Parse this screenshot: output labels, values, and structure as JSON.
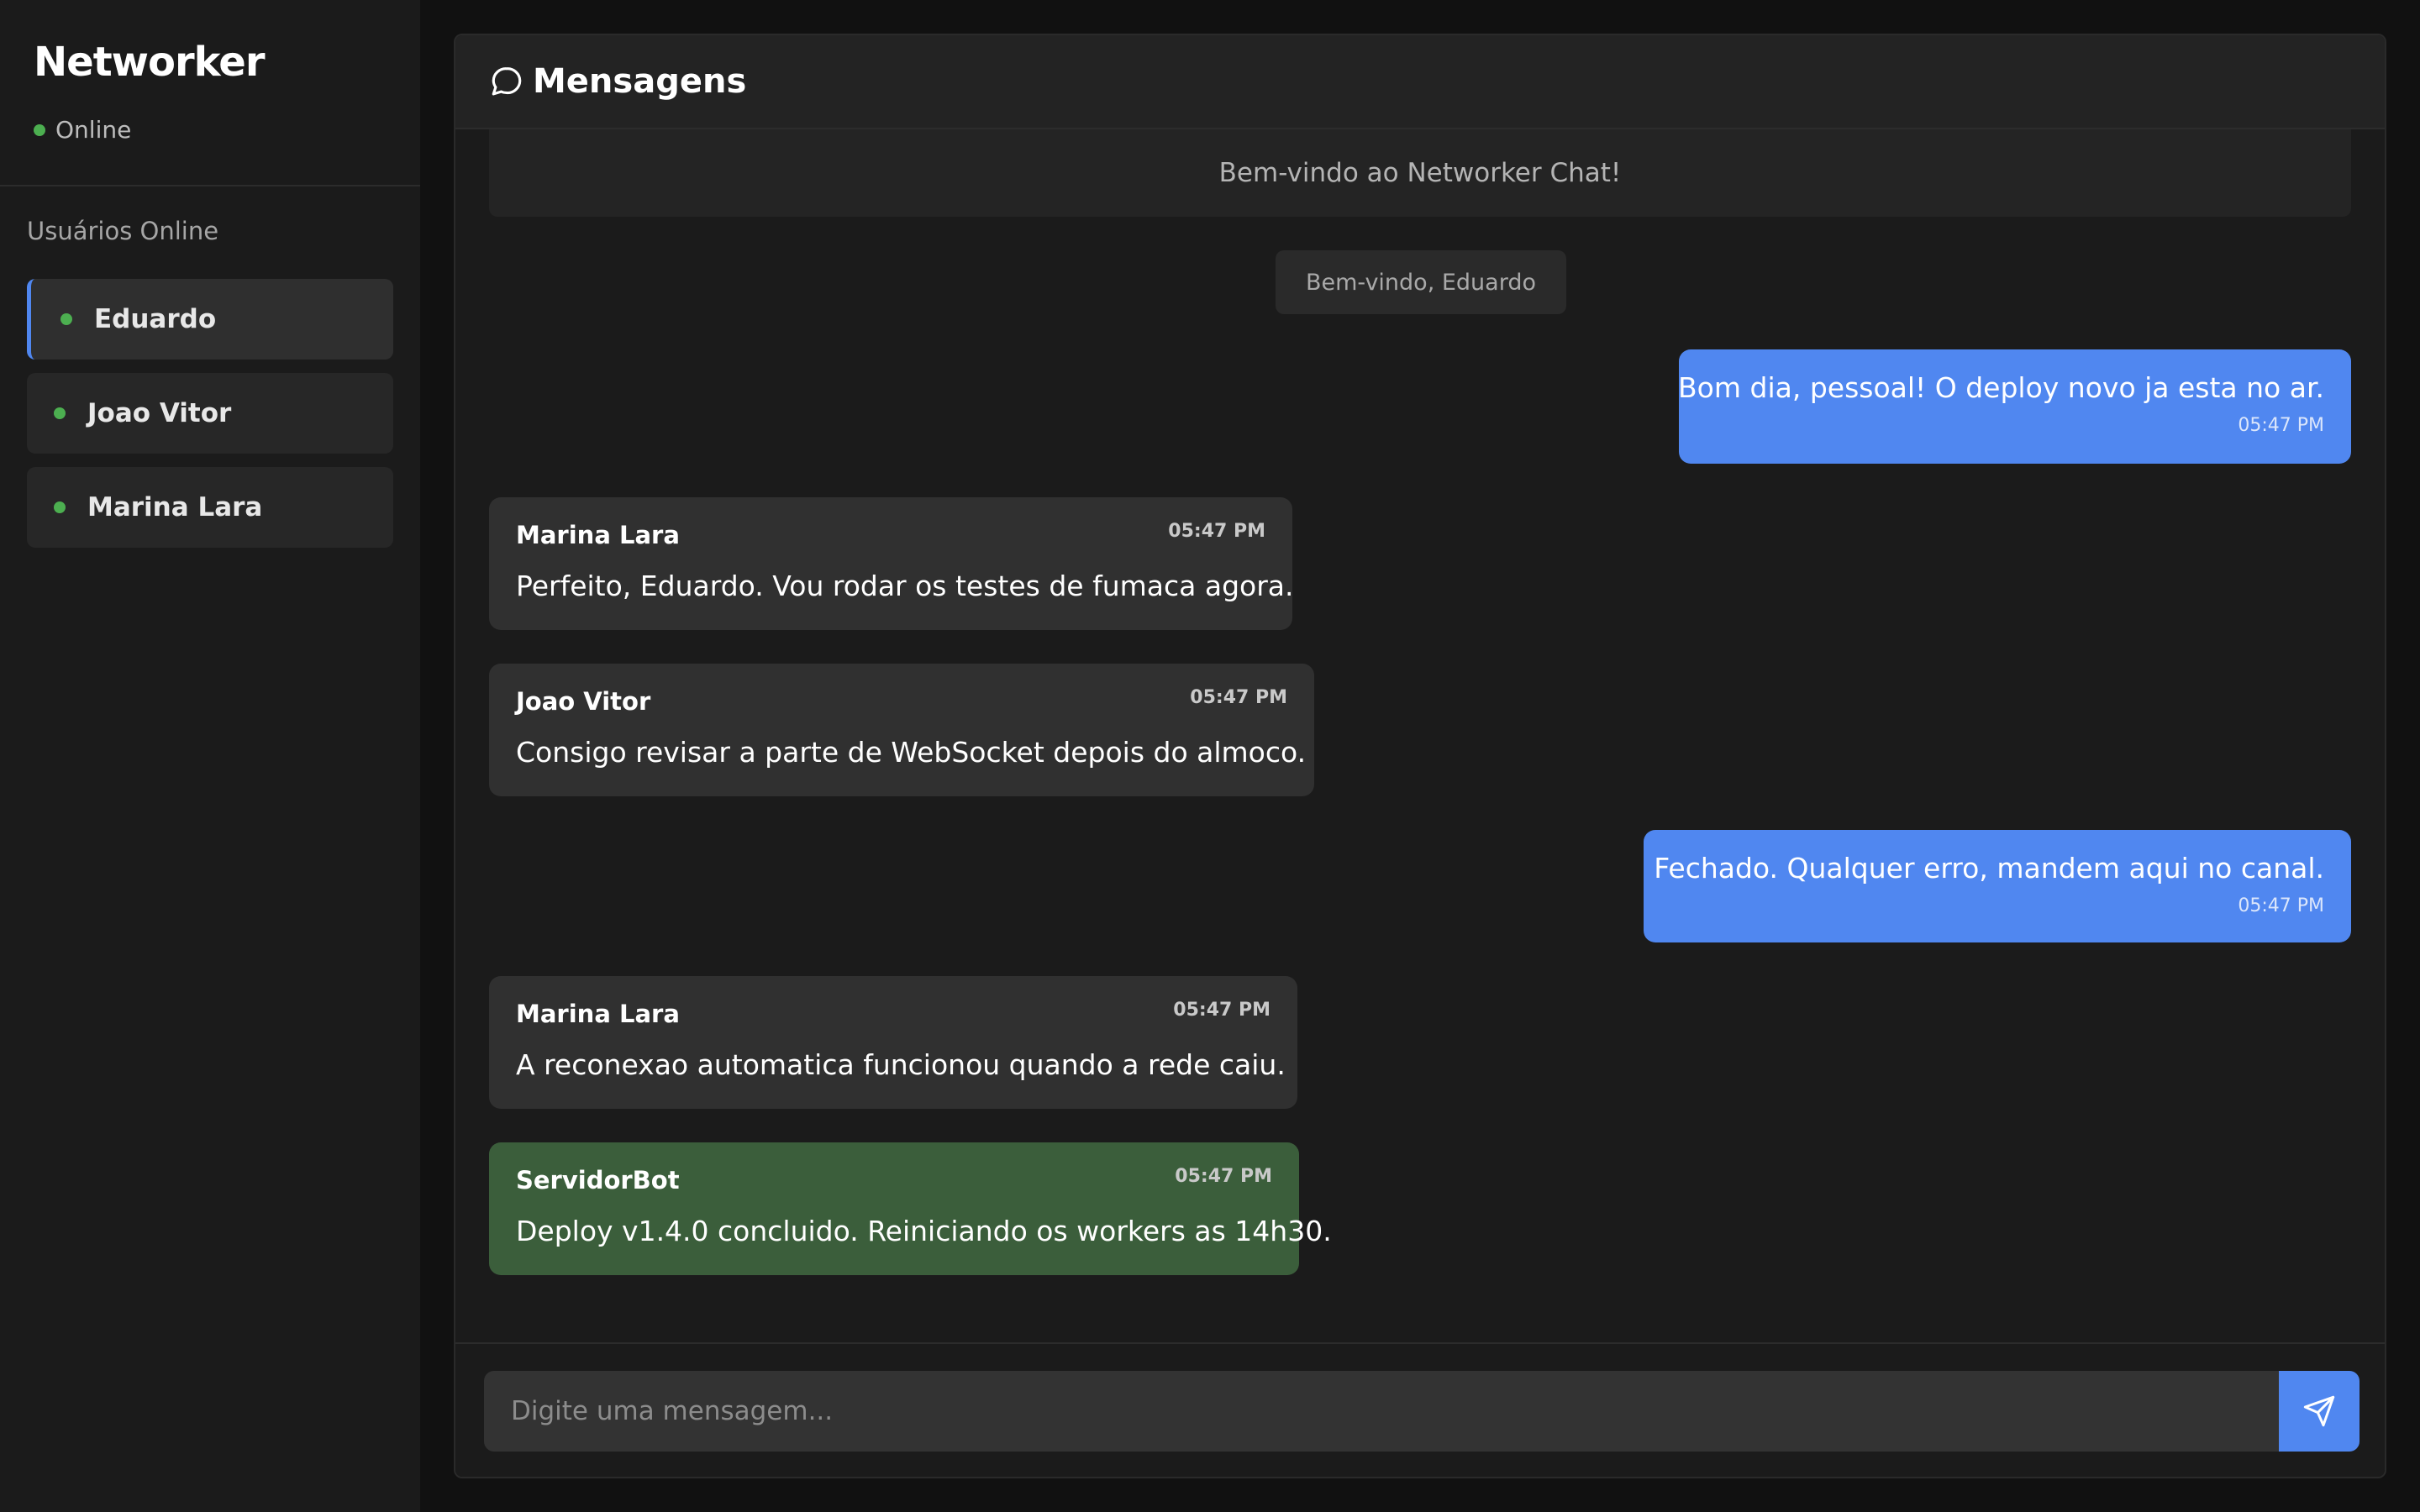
{
  "sidebar": {
    "app_name": "Networker",
    "status_text": "Online",
    "users_heading": "Usuários Online",
    "users": [
      {
        "name": "Eduardo",
        "active": true
      },
      {
        "name": "Joao Vitor",
        "active": false
      },
      {
        "name": "Marina Lara",
        "active": false
      }
    ]
  },
  "main": {
    "title": "Mensagens",
    "title_icon": "chat-bubble-icon",
    "welcome_banner": "Bem-vindo ao Networker Chat!",
    "system_notice": "Bem-vindo, Eduardo",
    "messages": [
      {
        "type": "self",
        "text": "Bom dia, pessoal! O deploy novo ja esta no ar.",
        "time": "05:47 PM"
      },
      {
        "type": "other",
        "sender": "Marina Lara",
        "text": "Perfeito, Eduardo. Vou rodar os testes de fumaca agora.",
        "time": "05:47 PM"
      },
      {
        "type": "other",
        "sender": "Joao Vitor",
        "text": "Consigo revisar a parte de WebSocket depois do almoco.",
        "time": "05:47 PM"
      },
      {
        "type": "self",
        "text": "Fechado. Qualquer erro, mandem aqui no canal.",
        "time": "05:47 PM"
      },
      {
        "type": "other",
        "sender": "Marina Lara",
        "text": "A reconexao automatica funcionou quando a rede caiu.",
        "time": "05:47 PM"
      },
      {
        "type": "bot",
        "sender": "ServidorBot",
        "text": "Deploy v1.4.0 concluido. Reiniciando os workers as 14h30.",
        "time": "05:47 PM"
      }
    ],
    "composer": {
      "placeholder": "Digite uma mensagem...",
      "value": "",
      "send_icon": "send-icon"
    }
  },
  "colors": {
    "accent": "#5087f0",
    "online": "#4caf50",
    "bot_bubble": "#3b5e3b",
    "other_bubble": "#303030",
    "background": "#111111"
  }
}
